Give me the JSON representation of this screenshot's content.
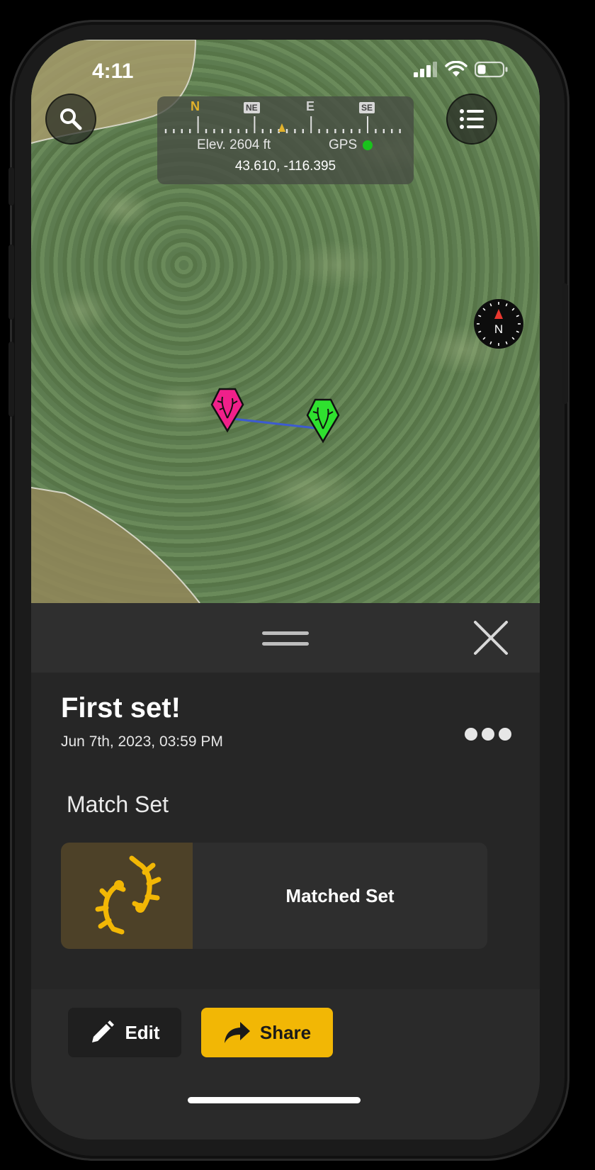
{
  "status_bar": {
    "time": "4:11",
    "icons": [
      "cellular-signal-icon",
      "wifi-icon",
      "battery-icon"
    ]
  },
  "map": {
    "compass_strip": {
      "headings": [
        "N",
        "NE",
        "E",
        "SE"
      ]
    },
    "elevation_text": "Elev. 2604 ft",
    "gps_label": "GPS",
    "gps_status_color": "#19c21c",
    "coordinates": "43.610, -116.395",
    "north_label": "N",
    "markers": [
      {
        "name": "pink-antler-marker",
        "color": "#f0208a"
      },
      {
        "name": "green-antler-marker",
        "color": "#2fe02f"
      }
    ],
    "connector_color": "#3d5bd0"
  },
  "sheet": {
    "title": "First set!",
    "date": "Jun 7th, 2023, 03:59 PM",
    "section_title": "Match Set",
    "matched_card_label": "Matched Set",
    "actions": {
      "edit_label": "Edit",
      "share_label": "Share"
    }
  },
  "colors": {
    "accent": "#f2b705",
    "sheet_background": "#262626"
  }
}
